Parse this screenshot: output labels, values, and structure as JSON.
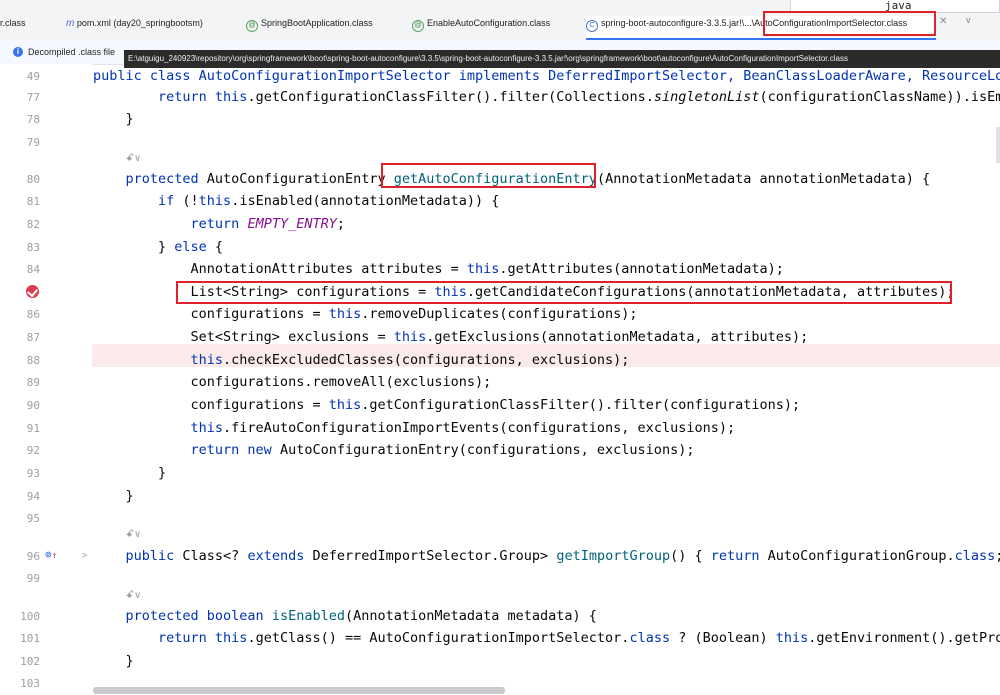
{
  "tabs": [
    {
      "label": "r.class",
      "icon": "",
      "icon_name": "none"
    },
    {
      "label": "pom.xml (day20_springbootsm)",
      "icon": "m",
      "icon_name": "maven-icon"
    },
    {
      "label": "SpringBootApplication.class",
      "icon": "@",
      "icon_name": "annotation-icon"
    },
    {
      "label": "EnableAutoConfiguration.class",
      "icon": "@",
      "icon_name": "annotation-icon"
    },
    {
      "label": "spring-boot-autoconfigure-3.3.5.jar!\\...\\AutoConfigurationImportSelector.class",
      "icon": "C",
      "icon_name": "class-icon"
    }
  ],
  "tooltip_java": "java",
  "info_bar": {
    "text": "Decompiled .class file"
  },
  "path_tooltip": "E:\\atguigu_240923\\repository\\org\\springframework\\boot\\spring-boot-autoconfigure\\3.3.5\\spring-boot-autoconfigure-3.3.5.jar!\\org\\springframework\\boot\\autoconfigure\\AutoConfigurationImportSelector.class",
  "gutter": {
    "line_numbers": [
      "49",
      "77",
      "78",
      "79",
      "",
      "80",
      "81",
      "82",
      "83",
      "84",
      "",
      "86",
      "87",
      "88",
      "89",
      "90",
      "91",
      "92",
      "93",
      "94",
      "95",
      "",
      "96",
      "99",
      "",
      "100",
      "101",
      "102",
      "103"
    ]
  },
  "code": {
    "l49": "public class AutoConfigurationImportSelector implements DeferredImportSelector, BeanClassLoaderAware, ResourceLoa",
    "l77_a": "        ",
    "l77_kw": "return this",
    "l77_b": ".getConfigurationClassFilter().filter(Collections.",
    "l77_it": "singletonList",
    "l77_c": "(configurationClassName)).isEmp",
    "l78": "    }",
    "hint1": "usages",
    "l80_kw": "    protected ",
    "l80_a": "AutoConfigurationEntry ",
    "l80_fn": "getAutoConfigurationEntry",
    "l80_b": "(AnnotationMetadata annotationMetadata) {",
    "l81_kw": "        if ",
    "l81_a": "(!",
    "l81_kw2": "this",
    "l81_b": ".isEnabled(annotationMetadata)) {",
    "l82_kw": "            return ",
    "l82_c": "EMPTY_ENTRY",
    "l82_b": ";",
    "l83_a": "        } ",
    "l83_kw": "else",
    "l83_b": " {",
    "l84_a": "            AnnotationAttributes attributes = ",
    "l84_kw": "this",
    "l84_b": ".getAttributes(annotationMetadata);",
    "l85_a": "            List<String> configurations = ",
    "l85_kw": "this",
    "l85_b": ".getCandidateConfigurations(annotationMetadata, attributes);",
    "l86_a": "            configurations = ",
    "l86_kw": "this",
    "l86_b": ".removeDuplicates(configurations);",
    "l87_a": "            Set<String> exclusions = ",
    "l87_kw": "this",
    "l87_b": ".getExclusions(annotationMetadata, attributes);",
    "l88_kw": "            this",
    "l88_b": ".checkExcludedClasses(configurations, exclusions);",
    "l89": "            configurations.removeAll(exclusions);",
    "l90_a": "            configurations = ",
    "l90_kw": "this",
    "l90_b": ".getConfigurationClassFilter().filter(configurations);",
    "l91_kw": "            this",
    "l91_b": ".fireAutoConfigurationImportEvents(configurations, exclusions);",
    "l92_kw": "            return new ",
    "l92_b": "AutoConfigurationEntry(configurations, exclusions);",
    "l93": "        }",
    "l94": "    }",
    "l96_kw": "    public ",
    "l96_a": "Class<? ",
    "l96_kw2": "extends ",
    "l96_b": "DeferredImportSelector.Group> ",
    "l96_fn": "getImportGroup",
    "l96_c": "() { ",
    "l96_kw3": "return ",
    "l96_d": "AutoConfigurationGroup.",
    "l96_kw4": "class",
    "l96_e": "; ",
    "l100_kw": "    protected boolean ",
    "l100_fn": "isEnabled",
    "l100_b": "(AnnotationMetadata metadata) {",
    "l101_kw": "        return this",
    "l101_b": ".getClass() == AutoConfigurationImportSelector.",
    "l101_kw2": "class",
    "l101_c": " ? (Boolean) ",
    "l101_kw3": "this",
    "l101_d": ".getEnvironment().getProp",
    "l102": "    }"
  },
  "colors": {
    "keyword": "#0033b3",
    "method": "#00627a",
    "constant": "#871094",
    "highlight_box": "#e0202a",
    "breakpoint": "#db3b4b"
  }
}
